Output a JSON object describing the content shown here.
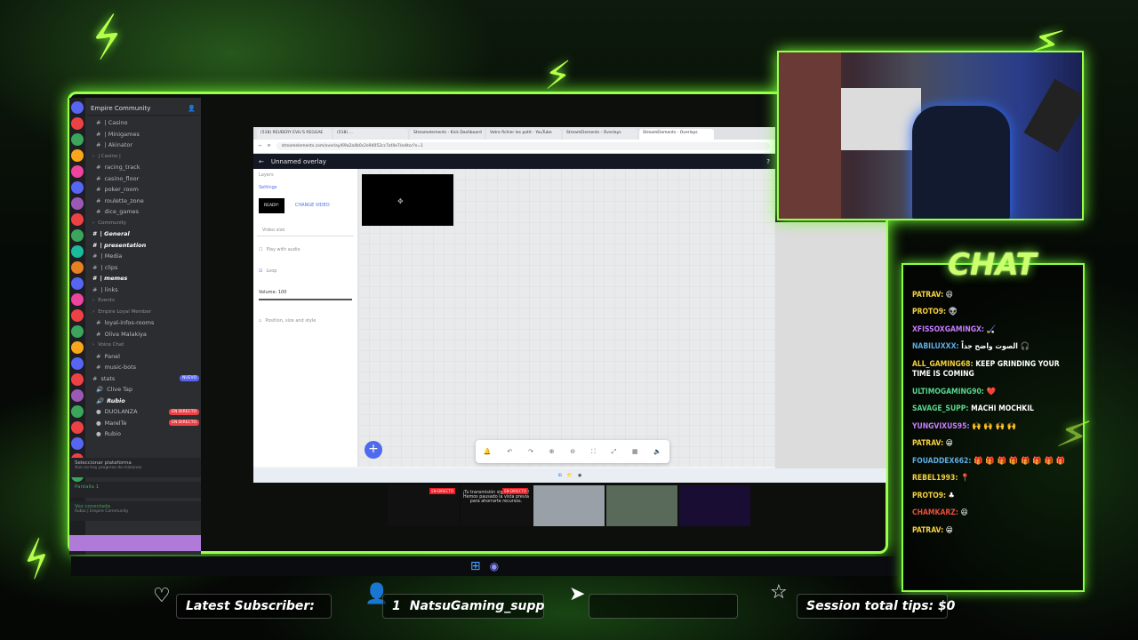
{
  "discord": {
    "server_title": "Empire Community",
    "channels": [
      {
        "label": "| Casino",
        "type": "text",
        "indent": true
      },
      {
        "label": "| Minigames",
        "type": "text",
        "indent": true
      },
      {
        "label": "| Akinator",
        "type": "text",
        "indent": true
      },
      {
        "label": "| Casino |",
        "type": "header",
        "indent": false
      },
      {
        "label": "racing_track",
        "type": "text",
        "indent": true
      },
      {
        "label": "casino_floor",
        "type": "text",
        "indent": true
      },
      {
        "label": "poker_room",
        "type": "text",
        "indent": true
      },
      {
        "label": "roulette_zone",
        "type": "text",
        "indent": true
      },
      {
        "label": "dice_games",
        "type": "text",
        "indent": true
      },
      {
        "label": "Community",
        "type": "header",
        "indent": false
      },
      {
        "label": "| General",
        "type": "text",
        "indent": false,
        "bold": true
      },
      {
        "label": "| presentation",
        "type": "text",
        "indent": false,
        "bold": true
      },
      {
        "label": "| Media",
        "type": "text",
        "indent": false
      },
      {
        "label": "| clips",
        "type": "text",
        "indent": false
      },
      {
        "label": "| memes",
        "type": "text",
        "indent": false,
        "bold": true
      },
      {
        "label": "| links",
        "type": "text",
        "indent": false
      },
      {
        "label": "Events",
        "type": "header",
        "indent": false
      },
      {
        "label": "Empire Loyal Member",
        "type": "header",
        "indent": false
      },
      {
        "label": "loyal-infos-rooms",
        "type": "text",
        "indent": true
      },
      {
        "label": "Oliva Malakiya",
        "type": "text",
        "indent": true
      },
      {
        "label": "Voice Chat",
        "type": "header",
        "indent": false
      },
      {
        "label": "Panel",
        "type": "text",
        "indent": true
      },
      {
        "label": "music-bots",
        "type": "text",
        "indent": true
      },
      {
        "label": "stats",
        "type": "text",
        "indent": false,
        "badge": "NUEVO",
        "badge_color": "blue"
      },
      {
        "label": "Clive Tap",
        "type": "voice",
        "indent": true
      },
      {
        "label": "Rubio",
        "type": "voice",
        "indent": true,
        "bold": true
      },
      {
        "label": "DUOLANZA",
        "type": "user",
        "indent": true,
        "badge": "EN DIRECTO"
      },
      {
        "label": "MarelTe",
        "type": "user",
        "indent": true,
        "badge": "EN DIRECTO"
      },
      {
        "label": "Rubio",
        "type": "user",
        "indent": true
      }
    ],
    "platform_label": "Seleccionar plataforma",
    "platform_sub": "Aún no hay progreso de misiones",
    "screen_label": "Pantalla 1",
    "voice_connected": "Voz conectada",
    "voice_sub": "Rubio | Empire Community"
  },
  "browser": {
    "tabs": [
      "(518) REUDERY EVIL'S REGGAE",
      "(518) ...",
      "Streamelements - Kick Dashboard",
      "Votre fichier les potit - YouTube",
      "StreamElements - Overlays",
      "StreamElements - Overlays"
    ],
    "url": "streamelements.com/overlay/69a2a4b0c2e94052cc7af4e7/editor?s=1",
    "page_title": "Unnamed overlay",
    "panel_items": [
      "Layers",
      "Settings"
    ],
    "ready_label": "READY!",
    "change_video": "CHANGE VIDEO",
    "video_size": "Video size",
    "play_audio": "Play with audio",
    "loop": "Loop",
    "volume": "Volume: 100",
    "volume_value": 1.0,
    "position": "Position, size and style",
    "toolbar_icons": [
      "bell-icon",
      "undo-icon",
      "redo-icon",
      "zoom-in-icon",
      "zoom-out-icon",
      "fullscreen-icon",
      "fit-icon",
      "grid-icon",
      "volume-icon"
    ]
  },
  "thumbs": [
    {
      "label": "",
      "live": "EN DIRECTO"
    },
    {
      "label": "¡Tu transmisión sigue en curso! Hemos pausado la vista previa para ahorrarte recursos.",
      "live": "EN DIRECTO"
    },
    {
      "label": "",
      "live": ""
    },
    {
      "label": "",
      "live": ""
    },
    {
      "label": "",
      "live": ""
    }
  ],
  "chat": {
    "title": "CHAT",
    "messages": [
      {
        "user": "PATRAV:",
        "text": "😆",
        "color": "#f4d03f"
      },
      {
        "user": "PROTO9:",
        "text": "👽",
        "color": "#f4d03f"
      },
      {
        "user": "XFISSOXGAMINGX:",
        "text": "🏑",
        "color": "#c77dff"
      },
      {
        "user": "NABILUXXX:",
        "text": "الصوت واضح جداً 🎧",
        "color": "#5dade2"
      },
      {
        "user": "ALL_GAMING68:",
        "text": "KEEP GRINDING YOUR TIME IS COMING",
        "color": "#f4d03f"
      },
      {
        "user": "ULTIMOGAMING90:",
        "text": "❤️",
        "color": "#58d68d"
      },
      {
        "user": "SAVAGE_SUPP:",
        "text": "MACHI MOCHKIL",
        "color": "#58d68d"
      },
      {
        "user": "YUNGVIXUS95:",
        "text": "🙌 🙌 🙌 🙌",
        "color": "#c77dff"
      },
      {
        "user": "PATRAV:",
        "text": "😁",
        "color": "#f4d03f"
      },
      {
        "user": "FOUADDEX662:",
        "text": "🎁 🎁 🎁 🎁 🎁 🎁 🎁 🎁",
        "color": "#5dade2"
      },
      {
        "user": "REBEL1993:",
        "text": "📍",
        "color": "#f4d03f"
      },
      {
        "user": "PROTO9:",
        "text": "♣",
        "color": "#f4d03f"
      },
      {
        "user": "CHAMKARZ:",
        "text": "😆",
        "color": "#e74c3c"
      },
      {
        "user": "PATRAV:",
        "text": "😁",
        "color": "#f4d03f"
      }
    ]
  },
  "bottom": {
    "latest_sub_label": "Latest Subscriber:",
    "subscriber": "NatsuGaming_supp",
    "subscriber_index": "1",
    "tips_label": "Session total tips: $0"
  }
}
